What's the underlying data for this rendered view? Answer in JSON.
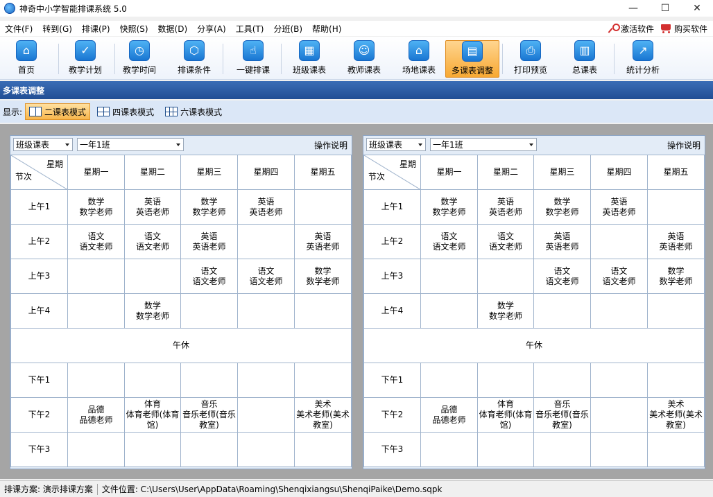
{
  "window": {
    "title": "神奇中小学智能排课系统 5.0",
    "minimize": "—",
    "maximize": "☐",
    "close": "✕"
  },
  "menu": {
    "items": [
      "文件(F)",
      "转到(G)",
      "排课(P)",
      "快照(S)",
      "数据(D)",
      "分享(A)",
      "工具(T)",
      "分班(B)",
      "帮助(H)"
    ],
    "activate": "激活软件",
    "buy": "购买软件"
  },
  "toolbar": {
    "buttons": [
      {
        "label": "首页",
        "glyph": "⌂",
        "icon": "home-icon"
      },
      {
        "label": "教学计划",
        "glyph": "✓",
        "icon": "clipboard-icon"
      },
      {
        "label": "教学时间",
        "glyph": "◷",
        "icon": "clock-icon"
      },
      {
        "label": "排课条件",
        "glyph": "⬡",
        "icon": "cubes-icon"
      },
      {
        "label": "一键排课",
        "glyph": "☝",
        "icon": "hand-icon"
      },
      {
        "label": "班级课表",
        "glyph": "▦",
        "icon": "calendar-icon"
      },
      {
        "label": "教师课表",
        "glyph": "☺",
        "icon": "teacher-icon"
      },
      {
        "label": "场地课表",
        "glyph": "⌂",
        "icon": "building-icon"
      },
      {
        "label": "多课表调整",
        "glyph": "▤",
        "icon": "multi-table-icon"
      },
      {
        "label": "打印预览",
        "glyph": "⎙",
        "icon": "printer-icon"
      },
      {
        "label": "总课表",
        "glyph": "▥",
        "icon": "master-table-icon"
      },
      {
        "label": "统计分析",
        "glyph": "↗",
        "icon": "chart-icon"
      }
    ],
    "active_index": 8
  },
  "section": {
    "title": "多课表调整"
  },
  "modes": {
    "label": "显示:",
    "items": [
      "二课表模式",
      "四课表模式",
      "六课表模式"
    ],
    "active_index": 0
  },
  "panels": [
    {
      "type_select": "班级课表",
      "class_select": "一年1班",
      "help": "操作说明"
    },
    {
      "type_select": "班级课表",
      "class_select": "一年1班",
      "help": "操作说明"
    }
  ],
  "timetable": {
    "corner_top": "星期",
    "corner_bottom": "节次",
    "days": [
      "星期一",
      "星期二",
      "星期三",
      "星期四",
      "星期五"
    ],
    "rows": [
      {
        "period": "上午1",
        "cells": [
          [
            "数学",
            "数学老师"
          ],
          [
            "英语",
            "英语老师"
          ],
          [
            "数学",
            "数学老师"
          ],
          [
            "英语",
            "英语老师"
          ],
          [
            "",
            ""
          ]
        ]
      },
      {
        "period": "上午2",
        "cells": [
          [
            "语文",
            "语文老师"
          ],
          [
            "语文",
            "语文老师"
          ],
          [
            "英语",
            "英语老师"
          ],
          [
            "",
            ""
          ],
          [
            "英语",
            "英语老师"
          ]
        ]
      },
      {
        "period": "上午3",
        "cells": [
          [
            "",
            ""
          ],
          [
            "",
            ""
          ],
          [
            "语文",
            "语文老师"
          ],
          [
            "语文",
            "语文老师"
          ],
          [
            "数学",
            "数学老师"
          ]
        ]
      },
      {
        "period": "上午4",
        "cells": [
          [
            "",
            ""
          ],
          [
            "数学",
            "数学老师"
          ],
          [
            "",
            ""
          ],
          [
            "",
            ""
          ],
          [
            "",
            ""
          ]
        ]
      },
      {
        "period": "",
        "break": "午休"
      },
      {
        "period": "下午1",
        "cells": [
          [
            "",
            ""
          ],
          [
            "",
            ""
          ],
          [
            "",
            ""
          ],
          [
            "",
            ""
          ],
          [
            "",
            ""
          ]
        ]
      },
      {
        "period": "下午2",
        "cells": [
          [
            "品德",
            "品德老师"
          ],
          [
            "体育",
            "体育老师(体育馆)"
          ],
          [
            "音乐",
            "音乐老师(音乐教室)"
          ],
          [
            "",
            ""
          ],
          [
            "美术",
            "美术老师(美术教室)"
          ]
        ]
      },
      {
        "period": "下午3",
        "cells": [
          [
            "",
            ""
          ],
          [
            "",
            ""
          ],
          [
            "",
            ""
          ],
          [
            "",
            ""
          ],
          [
            "",
            ""
          ]
        ]
      }
    ]
  },
  "status": {
    "plan": "排课方案: 演示排课方案",
    "file": "文件位置: C:\\Users\\User\\AppData\\Roaming\\Shenqixiangsu\\ShenqiPaike\\Demo.sqpk"
  }
}
